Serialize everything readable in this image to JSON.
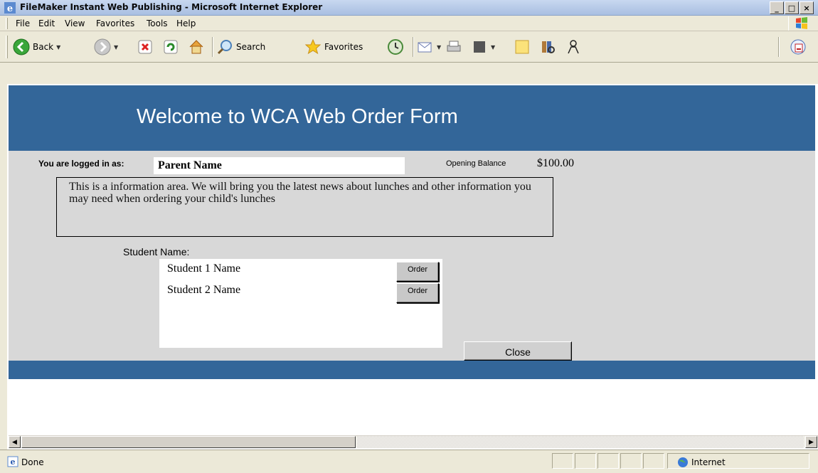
{
  "window": {
    "title": "FileMaker Instant Web Publishing - Microsoft Internet Explorer",
    "minimize": "_",
    "maximize": "□",
    "close": "×"
  },
  "menu": {
    "items": [
      {
        "label": "File"
      },
      {
        "label": "Edit"
      },
      {
        "label": "View"
      },
      {
        "label": "Favorites"
      },
      {
        "label": "Tools"
      },
      {
        "label": "Help"
      }
    ]
  },
  "toolbar": {
    "back_label": "Back",
    "search_label": "Search",
    "favorites_label": "Favorites"
  },
  "page": {
    "header_title": "Welcome to WCA Web Order Form",
    "login_label": "You are logged in as:",
    "login_value": "Parent Name",
    "opening_balance_label": "Opening Balance",
    "opening_balance_value": "$100.00",
    "info_text": "This is a information area.  We will bring you the latest news about lunches and other information you may need when ordering your child's lunches",
    "student_label": "Student Name:",
    "students": [
      {
        "name": "Student 1 Name",
        "button": "Order"
      },
      {
        "name": "Student 2 Name",
        "button": "Order"
      }
    ],
    "close_label": "Close"
  },
  "status": {
    "text": "Done",
    "zone": "Internet"
  },
  "colors": {
    "header_band": "#336699",
    "content_bg": "#d8d8d8"
  }
}
